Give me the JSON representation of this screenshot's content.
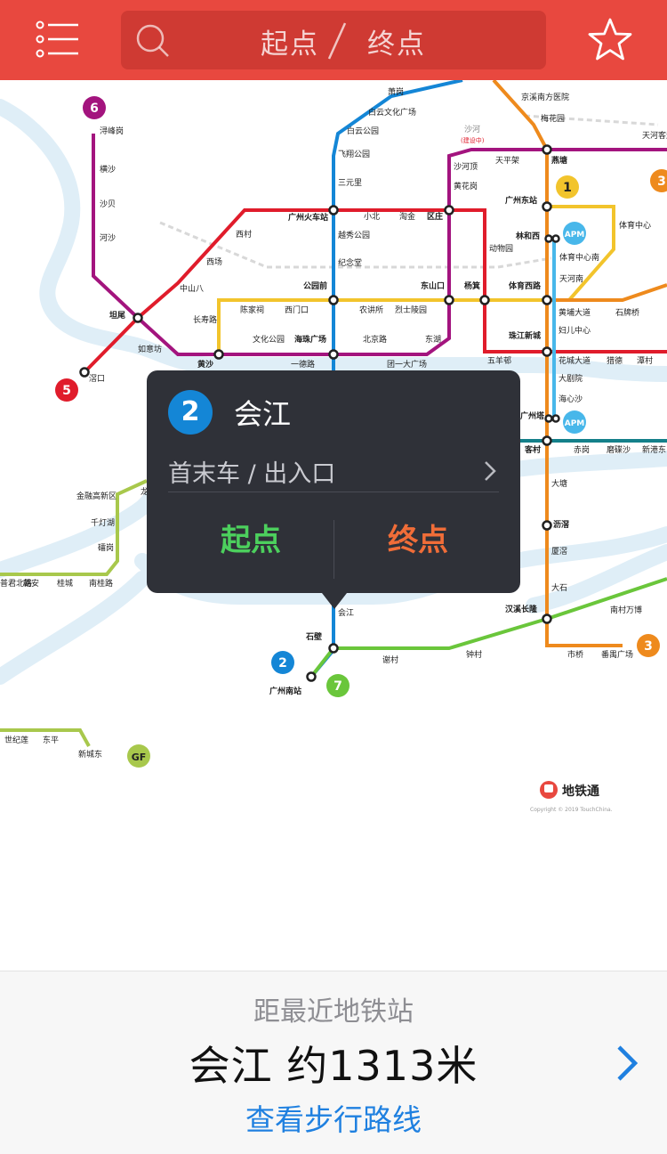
{
  "search": {
    "from_label": "起点",
    "to_label": "终点",
    "search_icon": "search-icon",
    "menu_icon": "menu-list-icon",
    "favorite_icon": "star-icon"
  },
  "colors": {
    "brand_red": "#e8483f",
    "line1": "#f2c42c",
    "line2": "#1486d6",
    "line3": "#ee8a1d",
    "line5": "#e01c2b",
    "line6": "#a3147e",
    "line7": "#6ac63b",
    "line8": "#14808a",
    "apm": "#48b7ea",
    "gf": "#a8c84c"
  },
  "map": {
    "line_badges": [
      "6",
      "5",
      "1",
      "3",
      "2",
      "7",
      "GF",
      "APM"
    ],
    "stations": {
      "s1": "萧岗",
      "s2": "白云文化广场",
      "s3": "白云公园",
      "s4": "飞翔公园",
      "s5": "三元里",
      "s6": "广州火车站",
      "s7": "小北",
      "s8": "淘金",
      "s9": "区庄",
      "s10": "越秀公园",
      "s11": "纪念堂",
      "s12": "公园前",
      "s13": "海珠广场",
      "s14": "一德路",
      "s15": "农讲所",
      "s16": "烈士陵园",
      "s17": "东山口",
      "s18": "杨箕",
      "s19": "北京路",
      "s20": "团一大广场",
      "s21": "东湖",
      "s22": "西门口",
      "s23": "陈家祠",
      "s24": "文化公园",
      "s25": "长寿路",
      "s26": "黄沙",
      "s27": "中山八",
      "s28": "西场",
      "s29": "西村",
      "s30": "坦尾",
      "s31": "如意坊",
      "s32": "滘口",
      "s33": "浔峰岗",
      "s34": "横沙",
      "s35": "沙贝",
      "s36": "河沙",
      "s37": "沙河顶",
      "s38": "黄花岗",
      "s39": "天平架",
      "s40": "沙河",
      "s41": "燕塘",
      "s42": "广州东站",
      "s43": "林和西",
      "s44": "体育中心",
      "s45": "体育中心南",
      "s46": "天河南",
      "s47": "体育西路",
      "s48": "动物园",
      "s49": "黄埔大道",
      "s50": "石牌桥",
      "s51": "珠江新城",
      "s52": "五羊邨",
      "s53": "妇儿中心",
      "s54": "花城大道",
      "s55": "猎德",
      "s56": "潭村",
      "s57": "大剧院",
      "s58": "海心沙",
      "s59": "广州塔",
      "s60": "客村",
      "s61": "赤岗",
      "s62": "磨碟沙",
      "s63": "新港东",
      "s64": "大塘",
      "s65": "沥滘",
      "s66": "厦滘",
      "s67": "大石",
      "s68": "汉溪长隆",
      "s69": "南村万博",
      "s70": "市桥",
      "s71": "番禺广场",
      "s72": "会江",
      "s73": "石壁",
      "s74": "谢村",
      "s75": "钟村",
      "s76": "广州南站",
      "s77": "金融高新区",
      "s78": "千灯湖",
      "s79": "礌岗",
      "s80": "南桂路",
      "s81": "桂城",
      "s82": "朝安",
      "s83": "普君北路",
      "s84": "世纪莲",
      "s85": "东平",
      "s86": "新城东",
      "s87": "京溪南方医院",
      "s88": "梅花园",
      "s89": "天河客运站",
      "s90": "沙河",
      "s91": "龙溪"
    },
    "note_under_construction": "(建设中)",
    "logo_text": "地铁通",
    "copyright": "Copyright © 2019 TouchChina."
  },
  "popup": {
    "line_number": "2",
    "station_name": "会江",
    "hours_label": "首末车 / 出入口",
    "set_from": "起点",
    "set_to": "终点"
  },
  "nearest": {
    "title": "距最近地铁站",
    "station_distance": "会江  约1313米",
    "walk_link": "查看步行路线"
  }
}
